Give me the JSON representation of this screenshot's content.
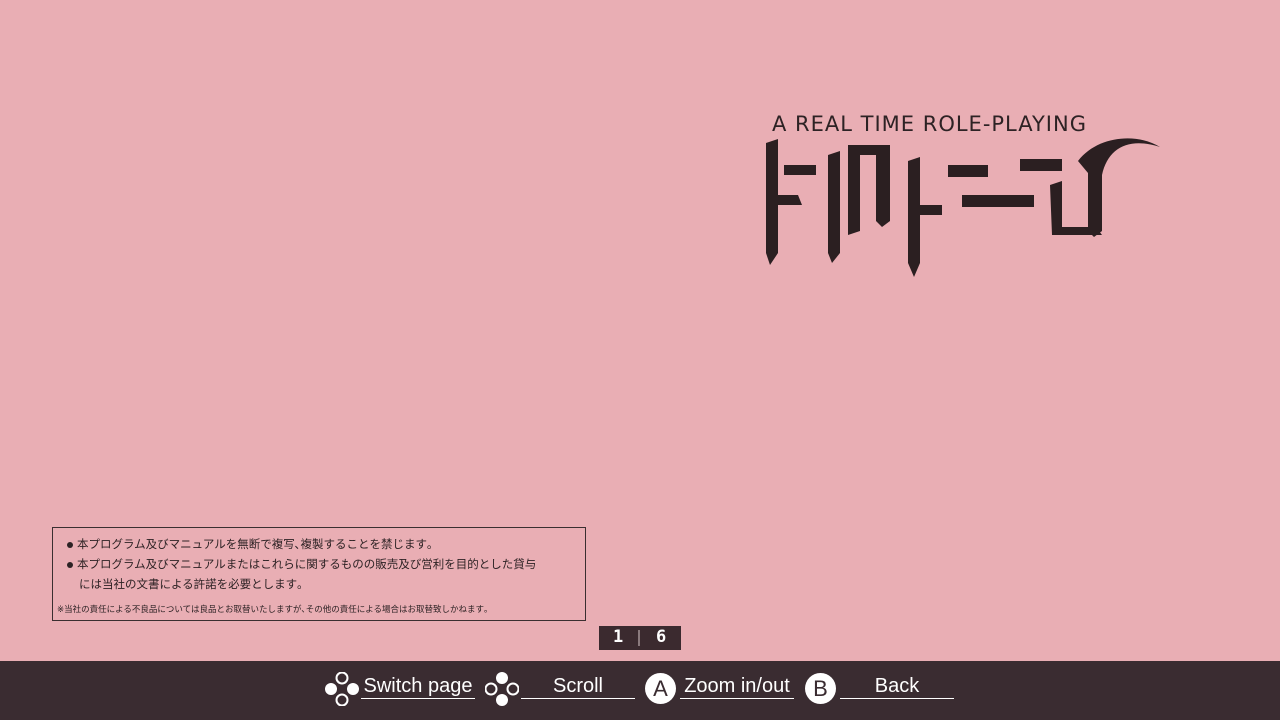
{
  "cover": {
    "subtitle": "A REAL TIME ROLE-PLAYING",
    "logo_text": "ドラゴンスレイヤー"
  },
  "notice": {
    "line1": "本プログラム及びマニュアルを無断で複写､複製することを禁じます｡",
    "line2": "本プログラム及びマニュアルまたはこれらに関するものの販売及び営利を目的とした貸与",
    "line3": "には当社の文書による許諾を必要とします｡",
    "footnote": "※当社の責任による不良品については良品とお取替いたしますが､その他の責任による場合はお取替致しかねます｡"
  },
  "pager": {
    "current": "1",
    "total": "6"
  },
  "controls": {
    "switch_page": "Switch page",
    "scroll": "Scroll",
    "zoom_button": "A",
    "zoom": "Zoom in/out",
    "back_button": "B",
    "back": "Back"
  },
  "colors": {
    "background": "#e9aeb4",
    "bar": "#3a2c31",
    "ink": "#2d2224"
  }
}
